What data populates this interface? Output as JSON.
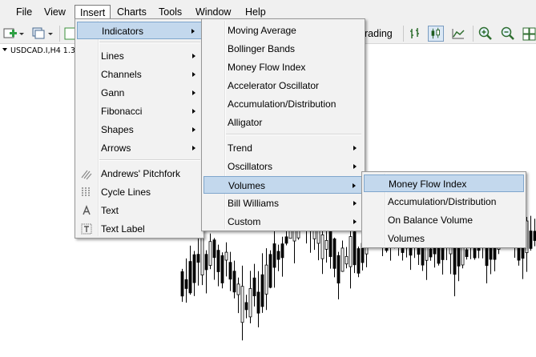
{
  "menubar": {
    "items": [
      "File",
      "View",
      "Insert",
      "Charts",
      "Tools",
      "Window",
      "Help"
    ],
    "active": "Insert"
  },
  "toolbar": {
    "trading_label": "rading"
  },
  "chart": {
    "title": "USDCAD.I,H4  1.3"
  },
  "insert_menu": {
    "items": [
      {
        "label": "Indicators",
        "submenu": true,
        "highlighted": true
      },
      {
        "label": "Lines",
        "submenu": true
      },
      {
        "label": "Channels",
        "submenu": true
      },
      {
        "label": "Gann",
        "submenu": true
      },
      {
        "label": "Fibonacci",
        "submenu": true
      },
      {
        "label": "Shapes",
        "submenu": true
      },
      {
        "label": "Arrows",
        "submenu": true
      },
      {
        "label": "Andrews' Pitchfork",
        "icon": "pitchfork-icon"
      },
      {
        "label": "Cycle Lines",
        "icon": "cycle-lines-icon"
      },
      {
        "label": "Text",
        "icon": "text-icon"
      },
      {
        "label": "Text Label",
        "icon": "text-label-icon"
      }
    ]
  },
  "indicators_menu": {
    "items": [
      {
        "label": "Moving Average"
      },
      {
        "label": "Bollinger Bands"
      },
      {
        "label": "Money Flow Index"
      },
      {
        "label": "Accelerator Oscillator"
      },
      {
        "label": "Accumulation/Distribution"
      },
      {
        "label": "Alligator"
      },
      {
        "label": "Trend",
        "submenu": true
      },
      {
        "label": "Oscillators",
        "submenu": true
      },
      {
        "label": "Volumes",
        "submenu": true,
        "highlighted": true
      },
      {
        "label": "Bill Williams",
        "submenu": true
      },
      {
        "label": "Custom",
        "submenu": true
      }
    ]
  },
  "volumes_menu": {
    "items": [
      {
        "label": "Money Flow Index",
        "highlighted": true
      },
      {
        "label": "Accumulation/Distribution"
      },
      {
        "label": "On Balance Volume"
      },
      {
        "label": "Volumes"
      }
    ]
  },
  "colors": {
    "highlight": "#c3d8ed",
    "highlight_border": "#7fa6cc",
    "menu_bg": "#f2f2f2"
  }
}
